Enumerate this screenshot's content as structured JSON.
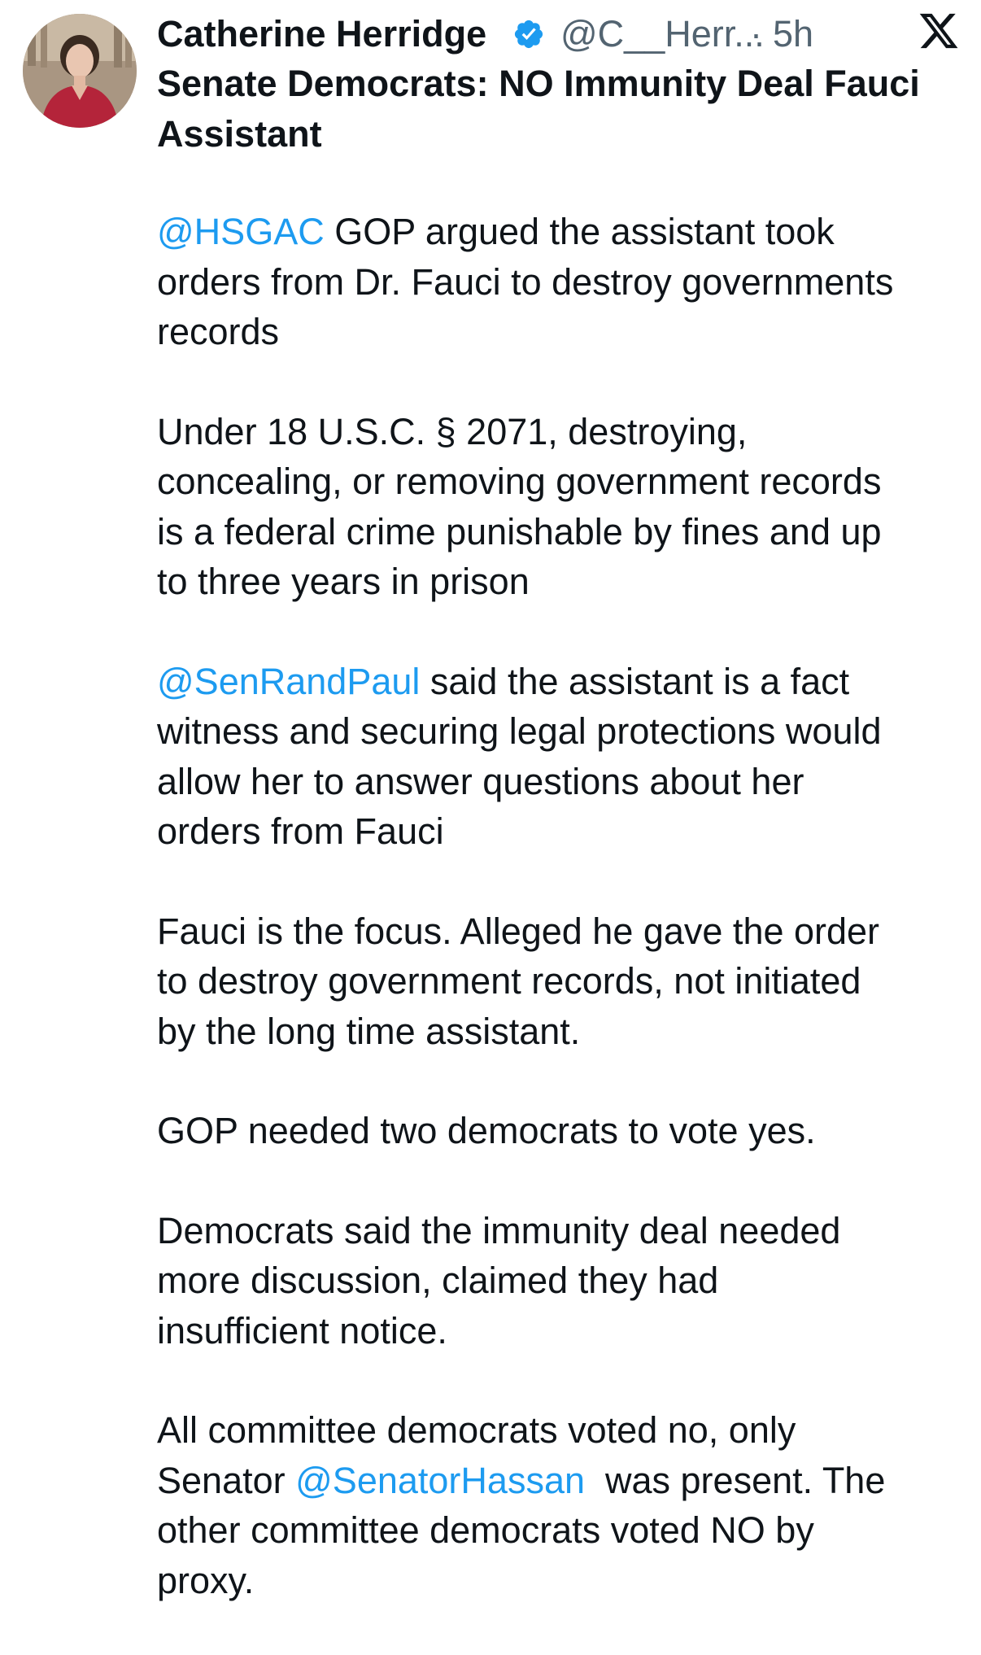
{
  "author": {
    "name": "Catherine Herridge",
    "handle": "@C__Herr...",
    "separator": "·",
    "time": "5h",
    "avatar_icon": "profile-photo",
    "verified_icon": "verified-badge-icon",
    "verified_color": "#1d9bf0"
  },
  "platform": {
    "logo_icon": "x-logo-icon"
  },
  "tweet": {
    "title_lines": [
      "Senate Democrats: NO Immunity Deal Fauci",
      "Assistant"
    ],
    "p1": {
      "mention": "@HSGAC",
      "l1_rest": " GOP argued the assistant took",
      "l2": "orders from Dr. Fauci to destroy governments",
      "l3": "records"
    },
    "p2": {
      "l1": "Under 18 U.S.C. § 2071, destroying,",
      "l2": "concealing, or removing government records",
      "l3": "is a federal crime punishable by fines and up",
      "l4": "to three years in prison"
    },
    "p3": {
      "mention": "@SenRandPaul",
      "l1_rest": " said the assistant is a fact",
      "l2": "witness and securing legal protections would",
      "l3": "allow her to answer questions about her",
      "l4": "orders from Fauci"
    },
    "p4": {
      "l1": "Fauci is the focus. Alleged he gave the order",
      "l2": "to destroy government records, not initiated",
      "l3": "by the long time assistant."
    },
    "p5": {
      "l1": "GOP needed two democrats to vote yes."
    },
    "p6": {
      "l1": "Democrats said the immunity deal needed",
      "l2": "more discussion, claimed they had",
      "l3": "insufficient notice."
    },
    "p7": {
      "l1": "All committee democrats voted no, only",
      "l2_pre": "Senator ",
      "mention": "@SenatorHassan",
      "l2_post": "  was present. The",
      "l3": "other committee democrats voted NO by",
      "l4": "proxy."
    }
  },
  "colors": {
    "text": "#0f1419",
    "secondary": "#536471",
    "link": "#1d9bf0"
  }
}
